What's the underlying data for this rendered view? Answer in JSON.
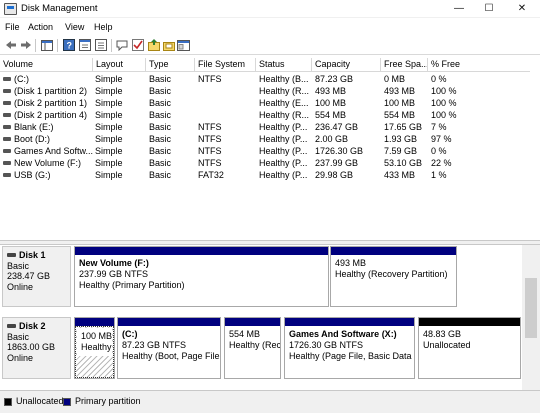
{
  "window": {
    "title": "Disk Management",
    "min_glyph": "—",
    "max_glyph": "☐",
    "close_glyph": "✕"
  },
  "menu": [
    "File",
    "Action",
    "View",
    "Help"
  ],
  "toolbar_icons": [
    "back-icon",
    "forward-icon",
    "console-tree-icon",
    "help-icon",
    "properties-icon",
    "refresh-icon",
    "rescan-icon",
    "checkmark-icon",
    "import-icon",
    "export-icon",
    "show-hide-icon"
  ],
  "volume_list": {
    "columns": [
      "Volume",
      "Layout",
      "Type",
      "File System",
      "Status",
      "Capacity",
      "Free Spa...",
      "% Free"
    ],
    "rows": [
      [
        "(C:)",
        "Simple",
        "Basic",
        "NTFS",
        "Healthy (B...",
        "87.23 GB",
        "0 MB",
        "0 %"
      ],
      [
        "(Disk 1 partition 2)",
        "Simple",
        "Basic",
        "",
        "Healthy (R...",
        "493 MB",
        "493 MB",
        "100 %"
      ],
      [
        "(Disk 2 partition 1)",
        "Simple",
        "Basic",
        "",
        "Healthy (E...",
        "100 MB",
        "100 MB",
        "100 %"
      ],
      [
        "(Disk 2 partition 4)",
        "Simple",
        "Basic",
        "",
        "Healthy (R...",
        "554 MB",
        "554 MB",
        "100 %"
      ],
      [
        "Blank (E:)",
        "Simple",
        "Basic",
        "NTFS",
        "Healthy (P...",
        "236.47 GB",
        "17.65 GB",
        "7 %"
      ],
      [
        "Boot (D:)",
        "Simple",
        "Basic",
        "NTFS",
        "Healthy (P...",
        "2.00 GB",
        "1.93 GB",
        "97 %"
      ],
      [
        "Games And Softw...",
        "Simple",
        "Basic",
        "NTFS",
        "Healthy (P...",
        "1726.30 GB",
        "7.59 GB",
        "0 %"
      ],
      [
        "New Volume (F:)",
        "Simple",
        "Basic",
        "NTFS",
        "Healthy (P...",
        "237.99 GB",
        "53.10 GB",
        "22 %"
      ],
      [
        "USB (G:)",
        "Simple",
        "Basic",
        "FAT32",
        "Healthy (P...",
        "29.98 GB",
        "433 MB",
        "1 %"
      ]
    ]
  },
  "disks": [
    {
      "name": "Disk 1",
      "type": "Basic",
      "size": "238.47 GB",
      "status": "Online",
      "partitions": [
        {
          "name": "New Volume  (F:)",
          "line1": "237.99 GB NTFS",
          "line2": "Healthy (Primary Partition)"
        },
        {
          "name": "",
          "line1": "493 MB",
          "line2": "Healthy (Recovery Partition)"
        }
      ]
    },
    {
      "name": "Disk 2",
      "type": "Basic",
      "size": "1863.00 GB",
      "status": "Online",
      "partitions": [
        {
          "name": "",
          "line1": "100 MB",
          "line2": "Healthy"
        },
        {
          "name": "(C:)",
          "line1": "87.23 GB NTFS",
          "line2": "Healthy (Boot, Page File,"
        },
        {
          "name": "",
          "line1": "554 MB",
          "line2": "Healthy (Rec"
        },
        {
          "name": "Games And Software  (X:)",
          "line1": "1726.30 GB NTFS",
          "line2": "Healthy (Page File, Basic Data Par"
        },
        {
          "name": "",
          "line1": "48.83 GB",
          "line2": "Unallocated"
        }
      ]
    }
  ],
  "legend": [
    {
      "label": "Unallocated",
      "color": "#000000"
    },
    {
      "label": "Primary partition",
      "color": "#00007f"
    }
  ]
}
